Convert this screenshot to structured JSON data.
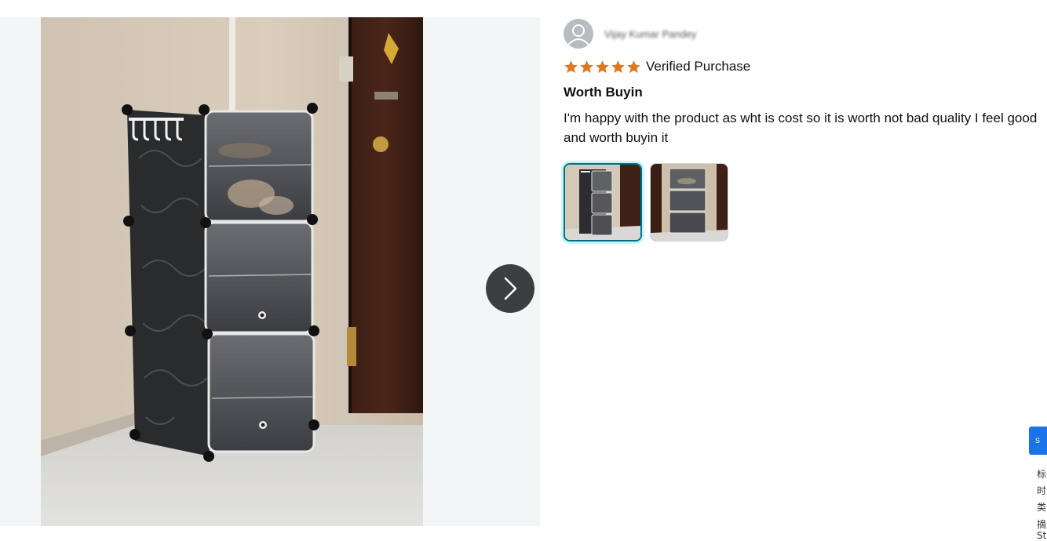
{
  "media": {
    "next_label": "Next image",
    "photo_alt": "Black cube shoe rack with three clear drop-front doors beside a wooden door"
  },
  "review": {
    "reviewer_name": "Vijay Kumar Pandey",
    "stars": 5,
    "verified_label": "Verified Purchase",
    "title": "Worth Buyin",
    "body": "I'm happy with the product as wht is cost so it is worth not bad quality I feel good and worth buyin it",
    "thumbnails": [
      {
        "label": "Review photo 1",
        "selected": true
      },
      {
        "label": "Review photo 2",
        "selected": false
      }
    ]
  },
  "colors": {
    "star": "#de7921",
    "selected_border": "#007185",
    "media_bg": "#f3f6f7"
  },
  "overlay": {
    "button_label": "S",
    "lines": [
      "标",
      "时",
      "类",
      "摘",
      "St"
    ]
  }
}
